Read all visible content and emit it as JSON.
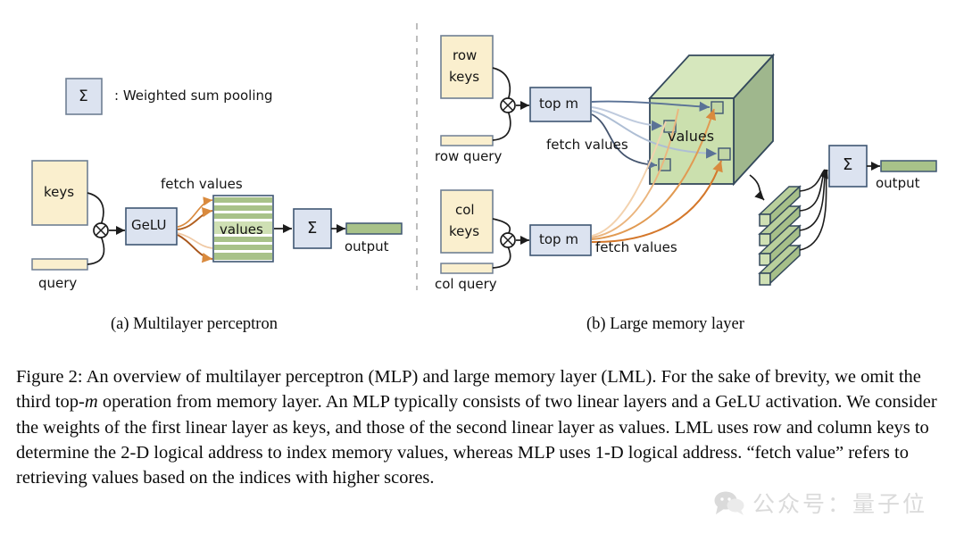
{
  "figure": {
    "legend": {
      "symbol": "Σ",
      "text": ": Weighted sum pooling"
    },
    "subcaptions": {
      "a": "(a) Multilayer perceptron",
      "b": "(b) Large memory layer"
    },
    "caption": {
      "prefix": "Figure 2:",
      "part1": " An overview of multilayer perceptron (MLP) and large memory layer (LML). For the sake of brevity, we omit the third top-",
      "italic1": "m",
      "part2": " operation from memory layer. An MLP typically consists of two linear layers and a GeLU activation. We consider the weights of the first linear layer as keys, and those of the second linear layer as values. LML uses row and column keys to determine the 2-D logical address to index memory values, whereas MLP uses 1-D logical address. “fetch value” refers to retrieving values based on the indices with higher scores."
    }
  },
  "panel_a": {
    "title": "(a) Multilayer perceptron",
    "keys_label": "keys",
    "query_label": "query",
    "op_symbol": "⊗",
    "activation_label": "GeLU",
    "fetch_label": "fetch values",
    "values_label": "values",
    "sum_symbol": "Σ",
    "output_label": "output"
  },
  "panel_b": {
    "title": "(b) Large memory layer",
    "row_keys_label": "row\nkeys",
    "row_keys_line1": "row",
    "row_keys_line2": "keys",
    "row_query_label": "row query",
    "col_keys_line1": "col",
    "col_keys_line2": "keys",
    "col_query_label": "col query",
    "op_symbol": "⊗",
    "topm_label": "top m",
    "fetch_label_top": "fetch values",
    "fetch_label_bottom": "fetch values",
    "values_label": "values",
    "sum_symbol": "Σ",
    "output_label": "output"
  },
  "watermark": {
    "text": "公众号：量子位"
  },
  "colors": {
    "keys_fill": "#FAEFCE",
    "keys_stroke": "#6F7F93",
    "box_fill": "#DCE3F0",
    "box_stroke": "#3F5673",
    "green_fill": "#A8C289",
    "green_light": "#CFE0B4",
    "cube_front": "#CBE0AE",
    "cube_top": "#D6E7BD",
    "cube_side": "#9FB78D",
    "cube_stroke": "#34495C",
    "arrow_blue": "#5A7296",
    "arrow_orange": "#D98A3E",
    "divider": "#BDBDBD"
  }
}
